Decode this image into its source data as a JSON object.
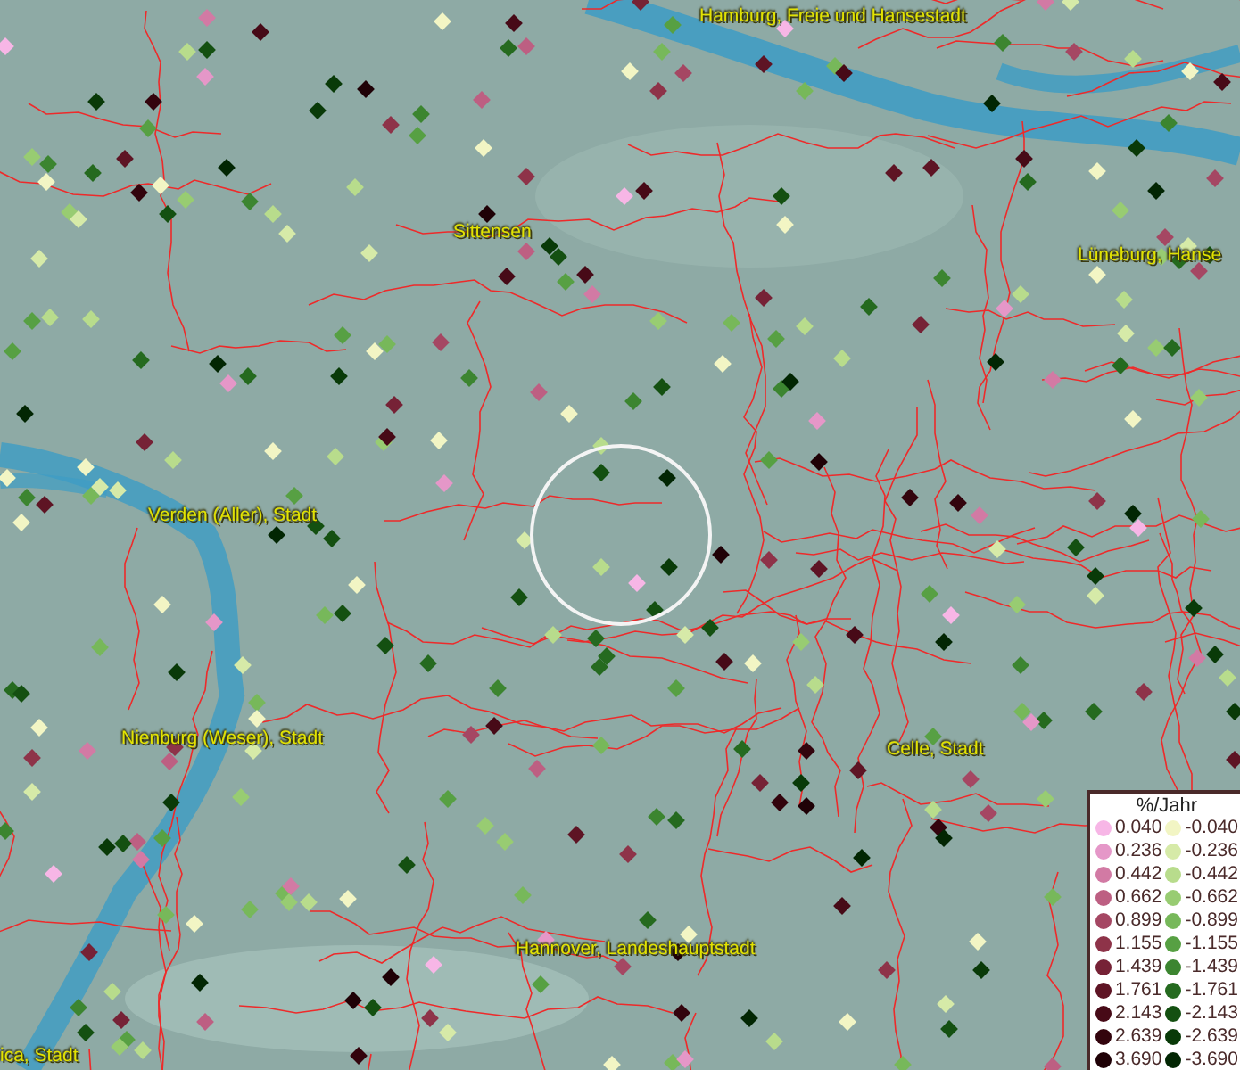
{
  "map": {
    "labels": [
      {
        "text": "Hamburg, Freie und Hansestadt"
      },
      {
        "text": "Sittensen"
      },
      {
        "text": "Lüneburg, Hanse"
      },
      {
        "text": "Verden (Aller), Stadt"
      },
      {
        "text": "Nienburg (Weser), Stadt"
      },
      {
        "text": "Celle, Stadt"
      },
      {
        "text": "Hannover, Landeshauptstadt"
      },
      {
        "text": "ica, Stadt"
      }
    ]
  },
  "legend": {
    "title": "%/Jahr",
    "rows": [
      {
        "positive": {
          "value": "0.040",
          "color": "#f7b6e6"
        },
        "negative": {
          "value": "-0.040",
          "color": "#f2f5c4"
        }
      },
      {
        "positive": {
          "value": "0.236",
          "color": "#e597c8"
        },
        "negative": {
          "value": "-0.236",
          "color": "#d6eaa8"
        }
      },
      {
        "positive": {
          "value": "0.442",
          "color": "#d27aa4"
        },
        "negative": {
          "value": "-0.442",
          "color": "#b8dc8c"
        }
      },
      {
        "positive": {
          "value": "0.662",
          "color": "#bd5f82"
        },
        "negative": {
          "value": "-0.662",
          "color": "#98cc72"
        }
      },
      {
        "positive": {
          "value": "0.899",
          "color": "#a54763"
        },
        "negative": {
          "value": "-0.899",
          "color": "#77b85a"
        }
      },
      {
        "positive": {
          "value": "1.155",
          "color": "#8e3349"
        },
        "negative": {
          "value": "-1.155",
          "color": "#57a043"
        }
      },
      {
        "positive": {
          "value": "1.439",
          "color": "#762236"
        },
        "negative": {
          "value": "-1.439",
          "color": "#3c8530"
        }
      },
      {
        "positive": {
          "value": "1.761",
          "color": "#5e1424"
        },
        "negative": {
          "value": "-1.761",
          "color": "#256a1f"
        }
      },
      {
        "positive": {
          "value": "2.143",
          "color": "#470a17"
        },
        "negative": {
          "value": "-2.143",
          "color": "#145011"
        }
      },
      {
        "positive": {
          "value": "2.639",
          "color": "#33040d"
        },
        "negative": {
          "value": "-2.639",
          "color": "#093a08"
        }
      },
      {
        "positive": {
          "value": "3.690",
          "color": "#1f0106"
        },
        "negative": {
          "value": "-3.690",
          "color": "#022603"
        }
      }
    ]
  }
}
